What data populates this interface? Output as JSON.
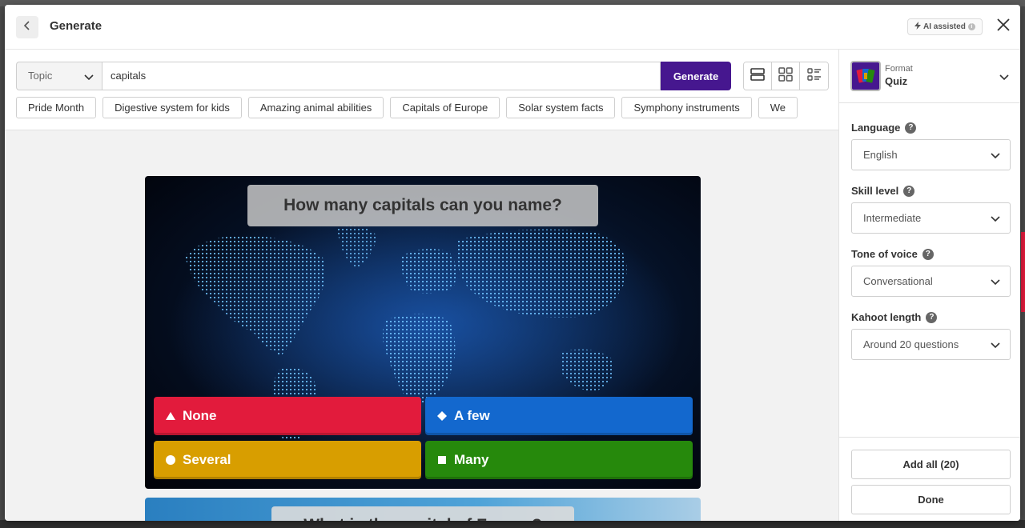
{
  "header": {
    "title": "Generate",
    "ai_badge": "AI assisted"
  },
  "search": {
    "mode": "Topic",
    "query": "capitals",
    "generate_label": "Generate"
  },
  "suggestions": [
    "Pride Month",
    "Digestive system for kids",
    "Amazing animal abilities",
    "Capitals of Europe",
    "Solar system facts",
    "Symphony instruments",
    "We"
  ],
  "quiz": {
    "question": "How many capitals can you name?",
    "answers": [
      {
        "label": "None",
        "color": "#e21b3c",
        "shape": "triangle"
      },
      {
        "label": "A few",
        "color": "#1368ce",
        "shape": "diamond"
      },
      {
        "label": "Several",
        "color": "#d89e00",
        "shape": "circle"
      },
      {
        "label": "Many",
        "color": "#26890c",
        "shape": "square"
      }
    ],
    "next_question": "What is the capital of France?"
  },
  "panel": {
    "format_label": "Format",
    "format_value": "Quiz",
    "language_label": "Language",
    "language_value": "English",
    "skill_label": "Skill level",
    "skill_value": "Intermediate",
    "tone_label": "Tone of voice",
    "tone_value": "Conversational",
    "length_label": "Kahoot length",
    "length_value": "Around 20 questions",
    "add_all_label": "Add all (20)",
    "done_label": "Done"
  },
  "colors": {
    "brand": "#46178f"
  }
}
